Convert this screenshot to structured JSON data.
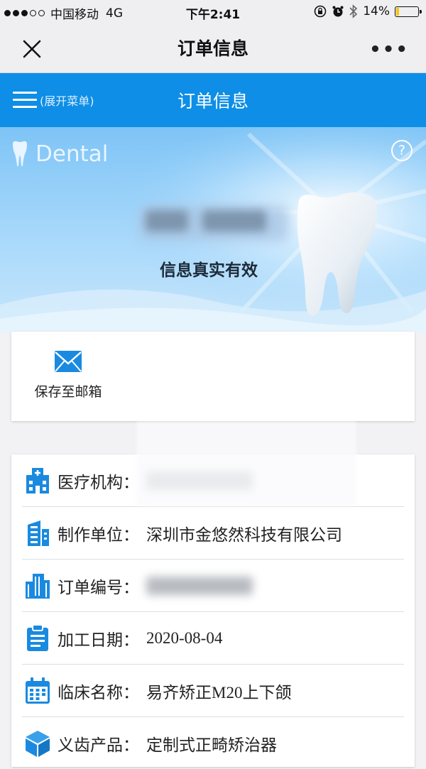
{
  "status_bar": {
    "carrier": "中国移动",
    "network": "4G",
    "time": "下午2:41",
    "battery_percent": "14%",
    "battery_level": 0.14,
    "signal_bars": 3,
    "signal_total": 5
  },
  "nav": {
    "title": "订单信息",
    "close_icon": "close-icon",
    "more_label": "•••"
  },
  "header": {
    "menu_label": "(展开菜单)",
    "title": "订单信息"
  },
  "hero": {
    "logo_text": "Dental",
    "help_label": "?",
    "caption": "信息真实有效"
  },
  "save": {
    "label": "保存至邮箱",
    "icon": "mail-icon"
  },
  "info": {
    "rows": [
      {
        "label": "医疗机构：",
        "value": "",
        "icon": "hospital-icon"
      },
      {
        "label": "制作单位：",
        "value": "深圳市金悠然科技有限公司",
        "icon": "building-icon"
      },
      {
        "label": "订单编号：",
        "value": "",
        "icon": "office-building-icon"
      },
      {
        "label": "加工日期：",
        "value": "2020-08-04",
        "icon": "clipboard-icon"
      },
      {
        "label": "临床名称：",
        "value": "易齐矫正M20上下颌",
        "icon": "calendar-icon"
      },
      {
        "label": "义齿产品：",
        "value": "定制式正畸矫治器",
        "icon": "cube-icon"
      }
    ]
  },
  "colors": {
    "accent": "#0e8ee6",
    "icon_blue": "#1a8ae0",
    "nav_bg": "#efeff2",
    "battery_fill": "#f5c518"
  }
}
